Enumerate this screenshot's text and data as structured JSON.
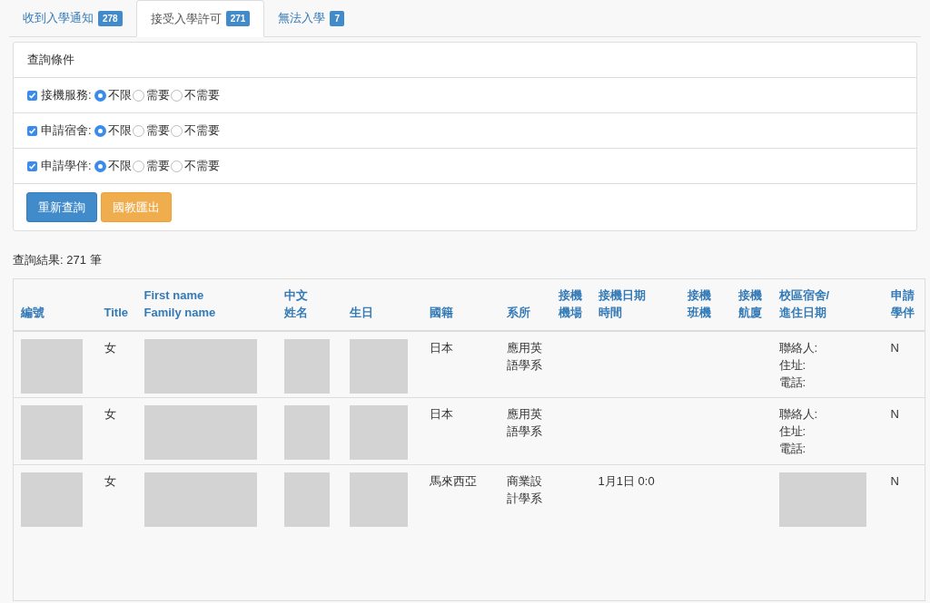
{
  "tabs": [
    {
      "label": "收到入學通知",
      "count": "278",
      "selected": false
    },
    {
      "label": "接受入學許可",
      "count": "271",
      "selected": true
    },
    {
      "label": "無法入學",
      "count": "7",
      "selected": false
    }
  ],
  "query_panel": {
    "title": "查詢條件",
    "filters": [
      {
        "label": "接機服務:",
        "checked": true,
        "options": [
          {
            "label": "不限",
            "selected": true
          },
          {
            "label": "需要",
            "selected": false
          },
          {
            "label": "不需要",
            "selected": false
          }
        ]
      },
      {
        "label": "申請宿舍:",
        "checked": true,
        "options": [
          {
            "label": "不限",
            "selected": true
          },
          {
            "label": "需要",
            "selected": false
          },
          {
            "label": "不需要",
            "selected": false
          }
        ]
      },
      {
        "label": "申請學伴:",
        "checked": true,
        "options": [
          {
            "label": "不限",
            "selected": true
          },
          {
            "label": "需要",
            "selected": false
          },
          {
            "label": "不需要",
            "selected": false
          }
        ]
      }
    ],
    "buttons": [
      {
        "label": "重新查詢",
        "kind": "primary"
      },
      {
        "label": "國教匯出",
        "kind": "warning"
      }
    ]
  },
  "result_summary": "查詢結果: 271 筆",
  "table": {
    "columns": [
      "編號",
      "Title",
      "First name\nFamily name",
      "中文姓名",
      "生日",
      "國籍",
      "系所",
      "接機機場",
      "接機日期時間",
      "接機班機",
      "接機航廈",
      "校區宿舍/\n進住日期",
      "申請學伴"
    ],
    "rows": [
      {
        "cells": [
          {
            "kind": "redacted"
          },
          {
            "kind": "text",
            "lines": [
              "女"
            ]
          },
          {
            "kind": "redacted"
          },
          {
            "kind": "redacted"
          },
          {
            "kind": "redacted"
          },
          {
            "kind": "text",
            "lines": [
              "日本"
            ]
          },
          {
            "kind": "text",
            "lines": [
              "應用英",
              "語學系"
            ]
          },
          {
            "kind": "empty"
          },
          {
            "kind": "empty"
          },
          {
            "kind": "empty"
          },
          {
            "kind": "empty"
          },
          {
            "kind": "text",
            "lines": [
              "聯絡人:",
              "住址:",
              "電話:"
            ]
          },
          {
            "kind": "text",
            "lines": [
              "N"
            ]
          }
        ]
      },
      {
        "cells": [
          {
            "kind": "redacted"
          },
          {
            "kind": "text",
            "lines": [
              "女"
            ]
          },
          {
            "kind": "redacted"
          },
          {
            "kind": "redacted"
          },
          {
            "kind": "redacted"
          },
          {
            "kind": "text",
            "lines": [
              "日本"
            ]
          },
          {
            "kind": "text",
            "lines": [
              "應用英",
              "語學系"
            ]
          },
          {
            "kind": "empty"
          },
          {
            "kind": "empty"
          },
          {
            "kind": "empty"
          },
          {
            "kind": "empty"
          },
          {
            "kind": "text",
            "lines": [
              "聯絡人:",
              "住址:",
              "電話:"
            ]
          },
          {
            "kind": "text",
            "lines": [
              "N"
            ]
          }
        ]
      },
      {
        "cells": [
          {
            "kind": "redacted"
          },
          {
            "kind": "text",
            "lines": [
              "女"
            ]
          },
          {
            "kind": "redacted"
          },
          {
            "kind": "redacted"
          },
          {
            "kind": "redacted"
          },
          {
            "kind": "text",
            "lines": [
              "馬來西亞"
            ]
          },
          {
            "kind": "text",
            "lines": [
              "商業設",
              "計學系"
            ]
          },
          {
            "kind": "empty"
          },
          {
            "kind": "text",
            "lines": [
              "1月1日 0:0"
            ]
          },
          {
            "kind": "empty"
          },
          {
            "kind": "empty"
          },
          {
            "kind": "redacted"
          },
          {
            "kind": "text",
            "lines": [
              "N"
            ]
          }
        ]
      }
    ]
  }
}
